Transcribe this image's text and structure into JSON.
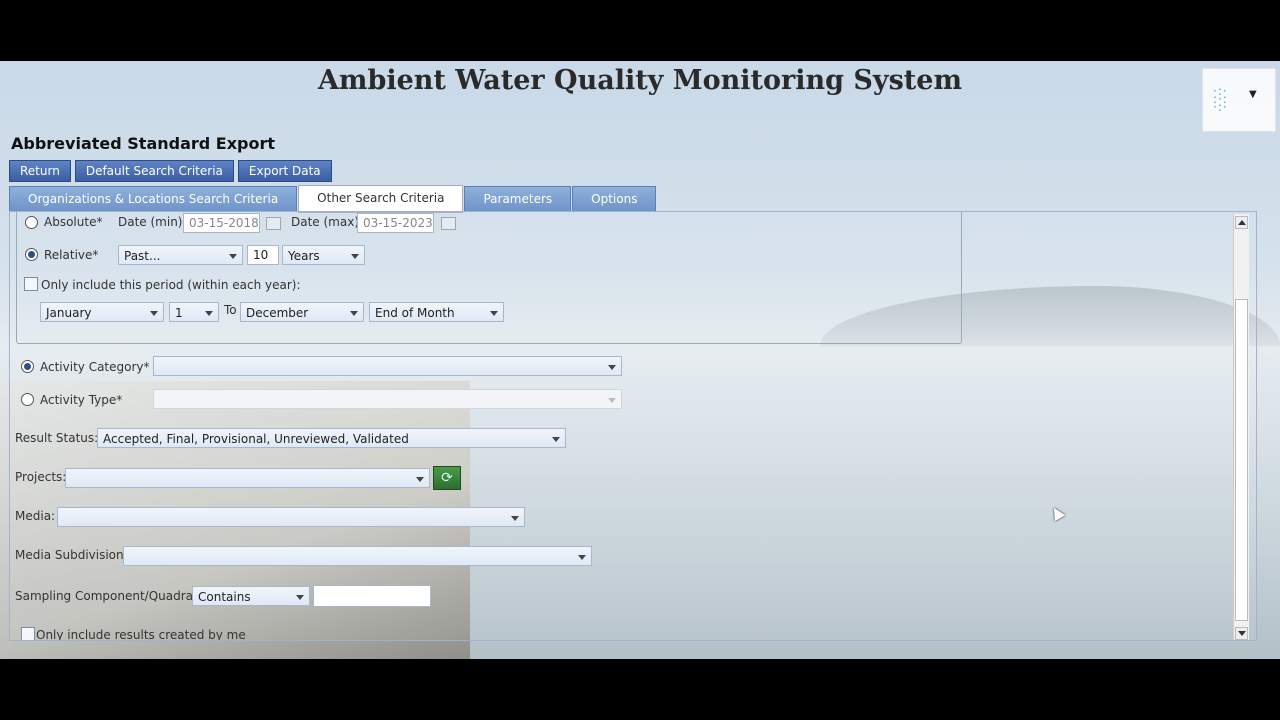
{
  "app": {
    "title": "Ambient Water Quality Monitoring System",
    "page_title": "Abbreviated Standard Export"
  },
  "toolbar": {
    "return_label": "Return",
    "default_label": "Default Search Criteria",
    "export_label": "Export Data"
  },
  "tabs": [
    {
      "label": "Organizations & Locations Search Criteria",
      "active": false
    },
    {
      "label": "Other Search Criteria",
      "active": true
    },
    {
      "label": "Parameters",
      "active": false
    },
    {
      "label": "Options",
      "active": false
    }
  ],
  "date": {
    "absolute_label": "Absolute*",
    "date_min_label": "Date (min):",
    "date_min_value": "03-15-2018",
    "date_max_label": "Date (max):",
    "date_max_value": "03-15-2023",
    "relative_label": "Relative*",
    "relative_mode": "Past...",
    "relative_count": "10",
    "relative_unit": "Years",
    "period_label": "Only include this period (within each year):",
    "from_month": "January",
    "from_day": "1",
    "to_label": "To",
    "to_month": "December",
    "to_day": "End of Month"
  },
  "activity": {
    "category_label": "Activity Category*",
    "category_value": "",
    "type_label": "Activity Type*",
    "type_value": ""
  },
  "result_status": {
    "label": "Result Status:*",
    "value": "Accepted, Final, Provisional, Unreviewed, Validated"
  },
  "projects": {
    "label": "Projects:",
    "value": ""
  },
  "media": {
    "label": "Media:",
    "value": ""
  },
  "media_subdivision": {
    "label": "Media Subdivision:",
    "value": ""
  },
  "sampling": {
    "label": "Sampling Component/Quadrat:",
    "operator": "Contains",
    "value": ""
  },
  "only_mine_label": "Only include results created by me",
  "icons": {
    "menu": "grid-dots-icon",
    "calendar": "calendar-icon",
    "refresh": "refresh-icon"
  },
  "colors": {
    "button_blue": "#3b5ea4",
    "tab_blue": "#6f94c8",
    "refresh_green": "#2e6e2e"
  }
}
